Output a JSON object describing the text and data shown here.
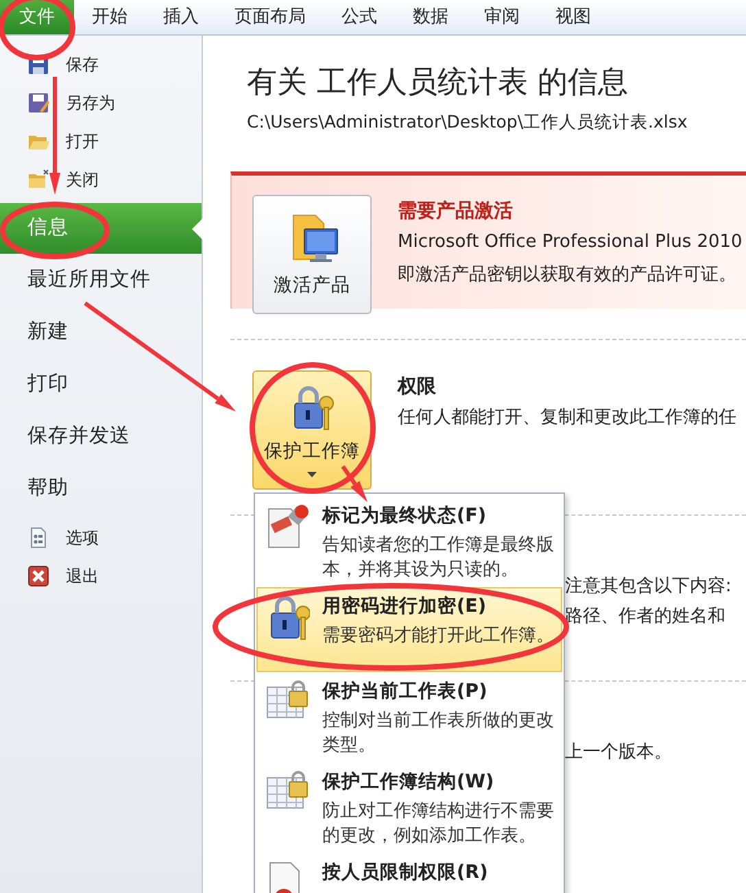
{
  "ribbon": {
    "tabs": [
      {
        "label": "文件",
        "selected": true
      },
      {
        "label": "开始",
        "selected": false
      },
      {
        "label": "插入",
        "selected": false
      },
      {
        "label": "页面布局",
        "selected": false
      },
      {
        "label": "公式",
        "selected": false
      },
      {
        "label": "数据",
        "selected": false
      },
      {
        "label": "审阅",
        "selected": false
      },
      {
        "label": "视图",
        "selected": false
      }
    ]
  },
  "nav": {
    "items": [
      {
        "label": "保存",
        "kind": "command",
        "selected": false
      },
      {
        "label": "另存为",
        "kind": "command",
        "selected": false
      },
      {
        "label": "打开",
        "kind": "command",
        "selected": false
      },
      {
        "label": "关闭",
        "kind": "command",
        "selected": false
      },
      {
        "label": "信息",
        "kind": "page",
        "selected": true
      },
      {
        "label": "最近所用文件",
        "kind": "page",
        "selected": false
      },
      {
        "label": "新建",
        "kind": "page",
        "selected": false
      },
      {
        "label": "打印",
        "kind": "page",
        "selected": false
      },
      {
        "label": "保存并发送",
        "kind": "page",
        "selected": false
      },
      {
        "label": "帮助",
        "kind": "page",
        "selected": false
      },
      {
        "label": "选项",
        "kind": "command",
        "selected": false
      },
      {
        "label": "退出",
        "kind": "command",
        "selected": false
      }
    ]
  },
  "info": {
    "title": "有关 工作人员统计表 的信息",
    "path": "C:\\Users\\Administrator\\Desktop\\工作人员统计表.xlsx",
    "activation": {
      "button": "激活产品",
      "heading": "需要产品激活",
      "lines": [
        "Microsoft Office Professional Plus 2010",
        "即激活产品密钥以获取有效的产品许可证。"
      ]
    },
    "permissions": {
      "button": "保护工作簿",
      "expanded": true,
      "heading": "权限",
      "text": "任何人都能打开、复制和更改此工作簿的任"
    },
    "inspect_lines": [
      "注意其包含以下内容:",
      "路径、作者的姓名和"
    ],
    "versions_line": "上一个版本。"
  },
  "protect_menu": {
    "items": [
      {
        "kind": "final",
        "title": "标记为最终状态(F)",
        "description": "告知读者您的工作簿是最终版本，并将其设为只读的。",
        "selected": false
      },
      {
        "kind": "encrypt",
        "title": "用密码进行加密(E)",
        "description": "需要密码才能打开此工作簿。",
        "selected": true
      },
      {
        "kind": "sheet",
        "title": "保护当前工作表(P)",
        "description": "控制对当前工作表所做的更改类型。",
        "selected": false
      },
      {
        "kind": "structure",
        "title": "保护工作簿结构(W)",
        "description": "防止对工作簿结构进行不需要的更改，例如添加工作表。",
        "selected": false
      },
      {
        "kind": "restrict",
        "title": "按人员限制权限(R)",
        "selected": false
      }
    ]
  },
  "annotations": [
    {
      "kind": "circle"
    },
    {
      "kind": "arrow"
    },
    {
      "kind": "circle"
    },
    {
      "kind": "arrow"
    },
    {
      "kind": "circle"
    },
    {
      "kind": "arrow"
    },
    {
      "kind": "circle"
    }
  ]
}
